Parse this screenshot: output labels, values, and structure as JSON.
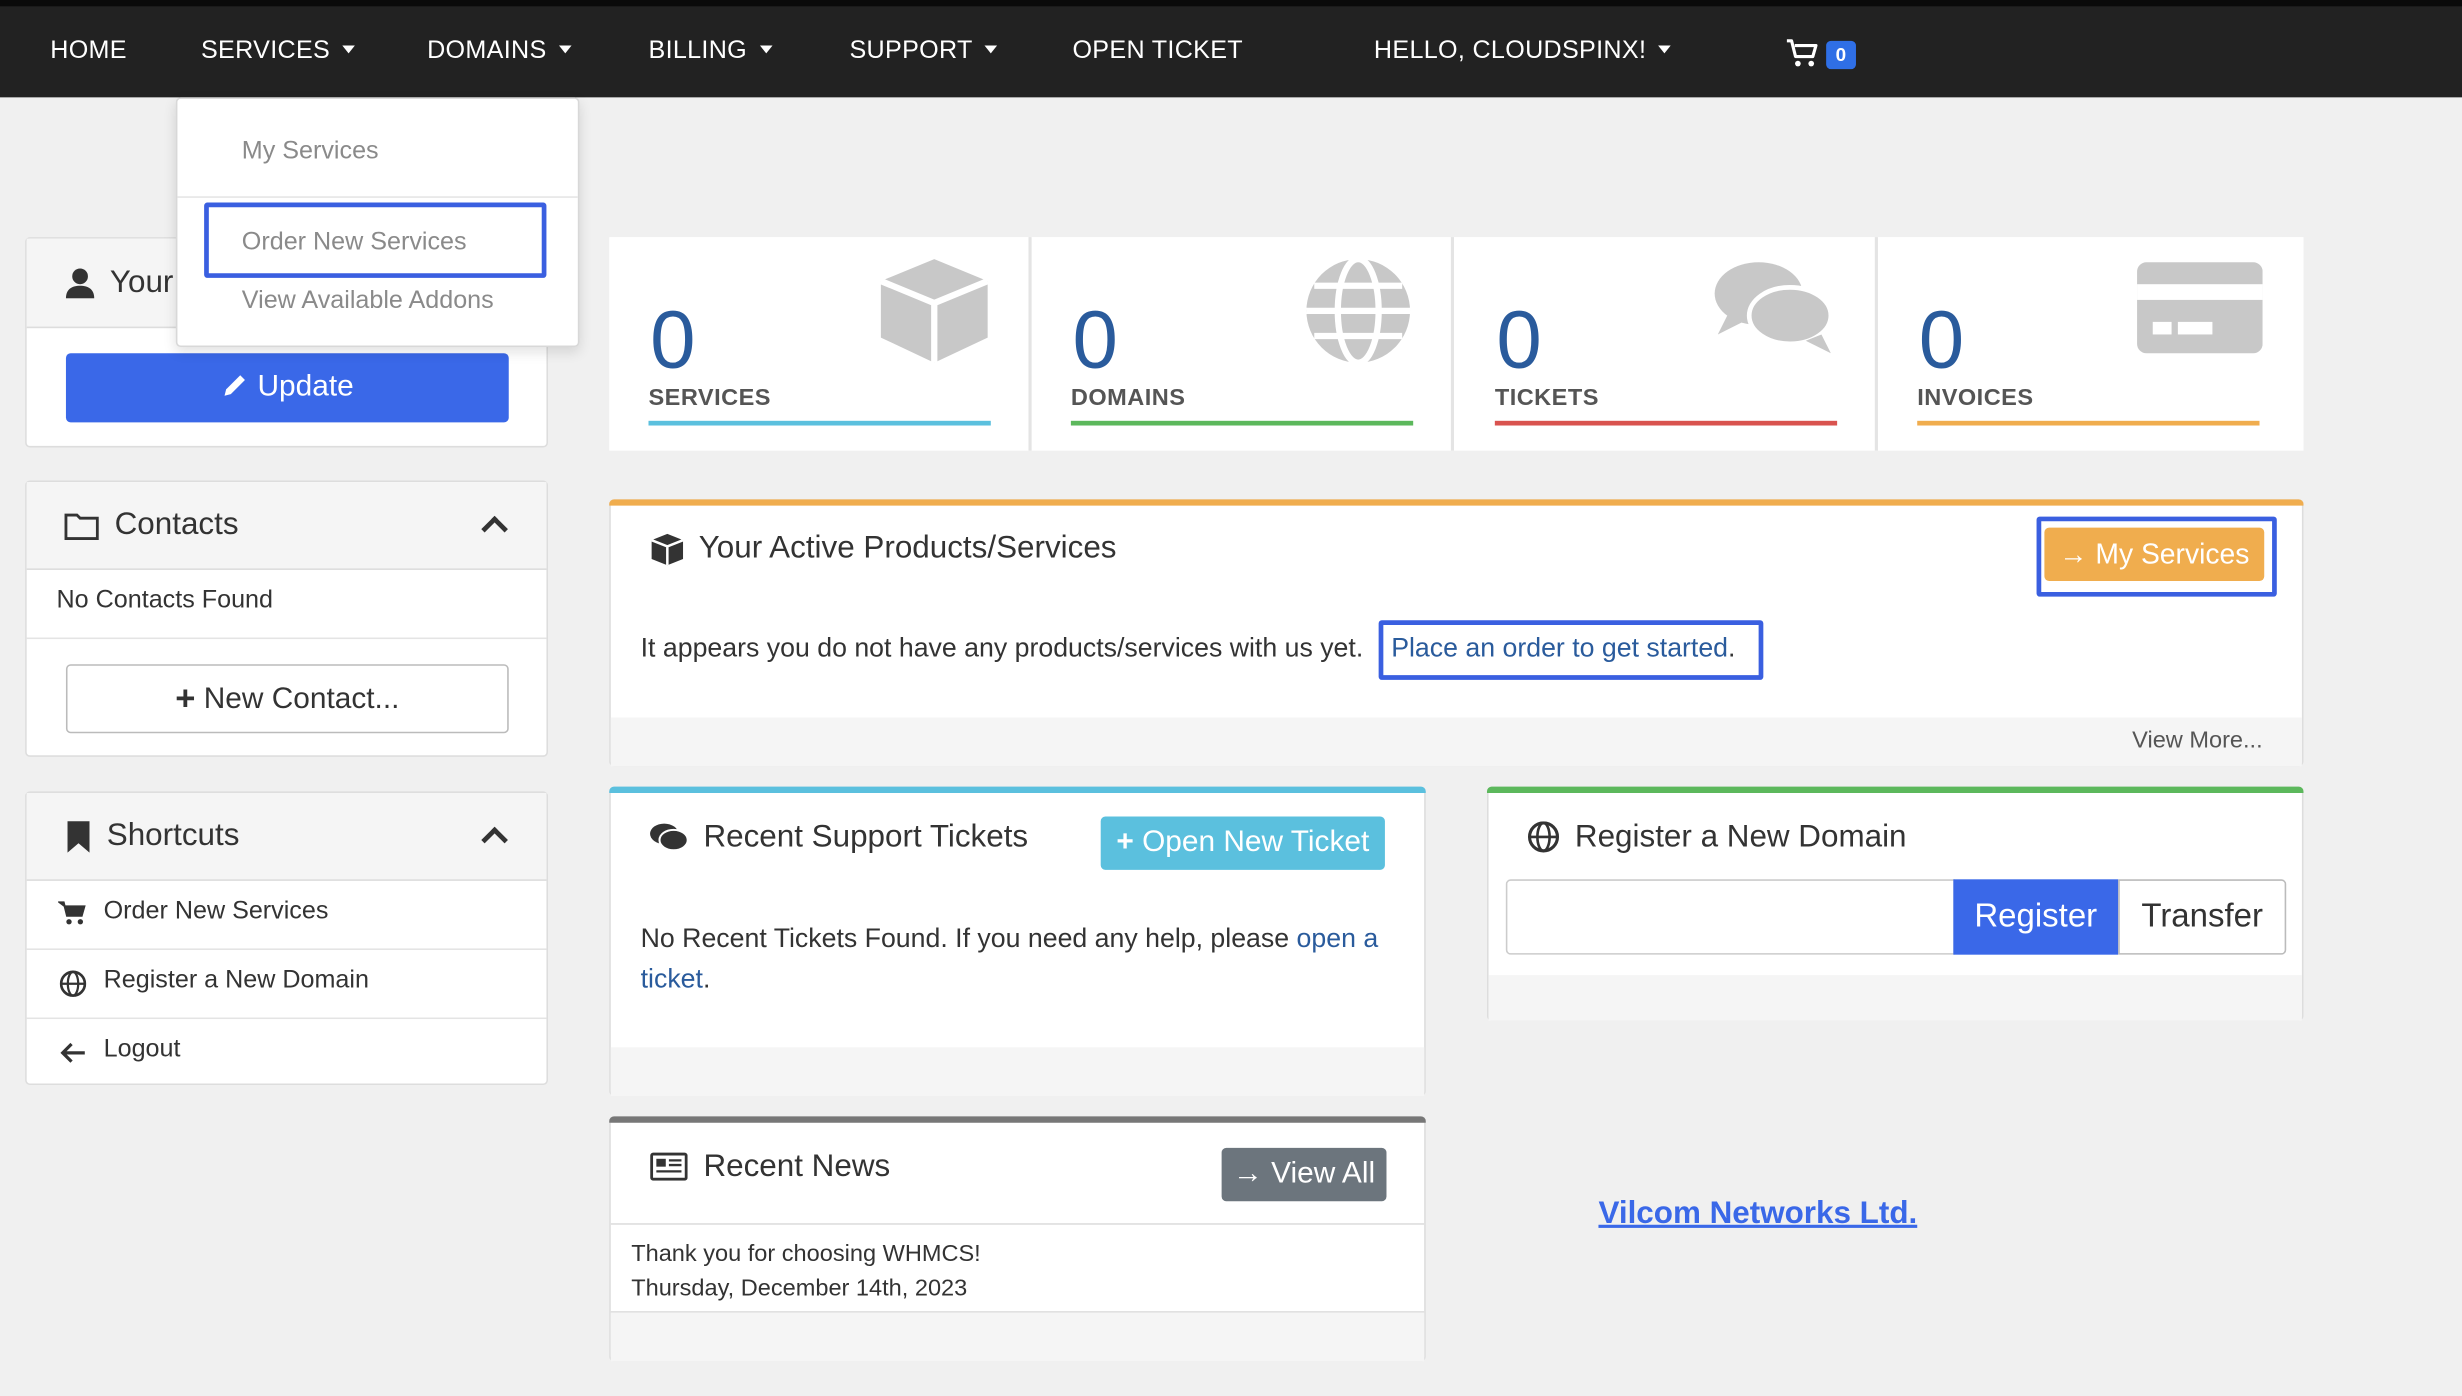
{
  "nav": {
    "home": "HOME",
    "services": "SERVICES",
    "domains": "DOMAINS",
    "billing": "BILLING",
    "support": "SUPPORT",
    "open_ticket": "OPEN TICKET",
    "user": "HELLO, CLOUDSPINX!",
    "cart_count": "0"
  },
  "services_menu": {
    "items": [
      "My Services",
      "Order New Services",
      "View Available Addons"
    ]
  },
  "profile_panel": {
    "title_partial": "Your",
    "update_button": "Update"
  },
  "contacts_panel": {
    "title": "Contacts",
    "empty_text": "No Contacts Found",
    "new_contact_button": "New Contact..."
  },
  "shortcuts_panel": {
    "title": "Shortcuts",
    "items": [
      "Order New Services",
      "Register a New Domain",
      "Logout"
    ]
  },
  "stats": [
    {
      "value": "0",
      "label": "SERVICES",
      "color": "#5bc0de"
    },
    {
      "value": "0",
      "label": "DOMAINS",
      "color": "#5cb85c"
    },
    {
      "value": "0",
      "label": "TICKETS",
      "color": "#d9534f"
    },
    {
      "value": "0",
      "label": "INVOICES",
      "color": "#f0ad4e"
    }
  ],
  "active_products": {
    "title": "Your Active Products/Services",
    "button": "My Services",
    "body_text": "It appears you do not have any products/services with us yet.",
    "link_text": "Place an order to get started",
    "link_suffix": ".",
    "footer_link": "View More..."
  },
  "support_tickets": {
    "title": "Recent Support Tickets",
    "button": "Open New Ticket",
    "body_text": "No Recent Tickets Found. If you need any help, please",
    "link_part1": "open a",
    "link_part2": "ticket",
    "suffix": "."
  },
  "register_domain": {
    "title": "Register a New Domain",
    "input_value": "",
    "register_button": "Register",
    "transfer_button": "Transfer"
  },
  "recent_news": {
    "title": "Recent News",
    "button": "View All",
    "item_title": "Thank you for choosing WHMCS!",
    "item_date": "Thursday, December 14th, 2023"
  },
  "brand_link": "Vilcom Networks Ltd.",
  "colors": {
    "accent_blue": "#3a68e8",
    "highlight": "#3a5fe0",
    "warning": "#f0ad4e",
    "info": "#5bc0de",
    "success": "#5cb85c",
    "danger": "#d9534f",
    "nav_bg": "#222222"
  }
}
